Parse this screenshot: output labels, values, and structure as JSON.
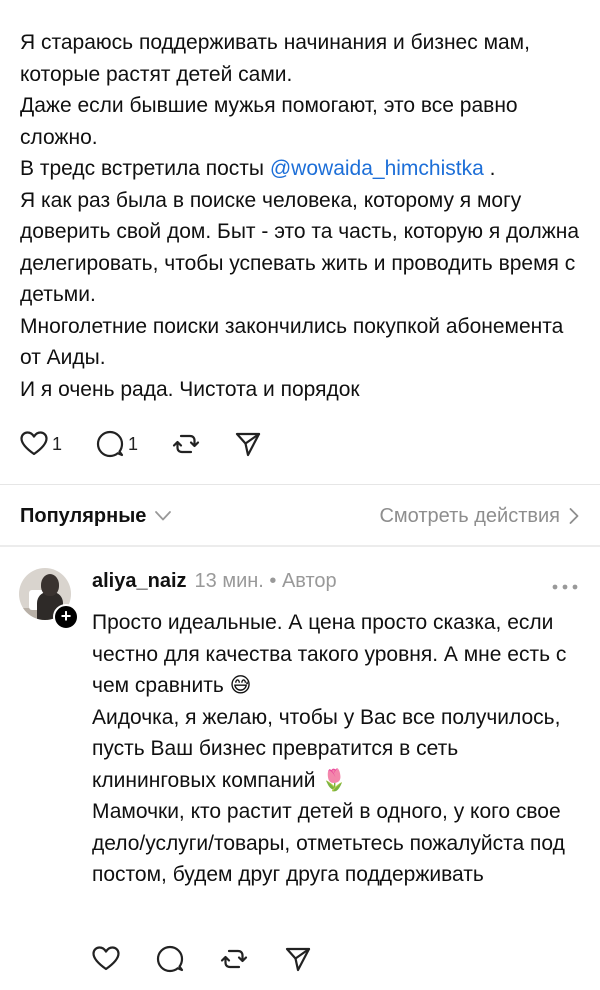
{
  "post": {
    "text_before_mention": "Я стараюсь поддерживать начинания и бизнес мам, которые растят детей сами.\nДаже если бывшие мужья помогают, это все равно сложно.\nВ тредс встретила посты ",
    "mention": "@wowaida_himchistka",
    "text_after_mention": " .\nЯ как раз была в поиске человека, которому я могу доверить свой дом. Быт - это та часть, которую я должна делегировать, чтобы успевать жить и проводить время с детьми.\nМноголетние поиски закончились покупкой абонемента от Аиды.\nИ я очень рада. Чистота и порядок",
    "likes": "1",
    "replies": "1"
  },
  "sort": {
    "label": "Популярные",
    "view_actions": "Смотреть действия"
  },
  "comment": {
    "username": "aliya_naiz",
    "meta": "13 мин. • Автор",
    "text": "Просто идеальные. А цена просто сказка, если честно для качества такого уровня. А мне есть с чем  сравнить 😅\nАидочка, я желаю, чтобы у Вас все получилось, пусть Ваш бизнес превратится в сеть клининговых компаний 🌷\nМамочки, кто растит детей в одного, у кого свое дело/услуги/товары, отметьтесь пожалуйста под постом, будем друг друга поддерживать"
  },
  "icons": {
    "like": "heart-icon",
    "reply": "comment-icon",
    "repost": "repost-icon",
    "share": "share-icon",
    "more": "more-icon",
    "chevron_down": "chevron-down-icon",
    "chevron_right": "chevron-right-icon",
    "follow": "plus-icon"
  }
}
